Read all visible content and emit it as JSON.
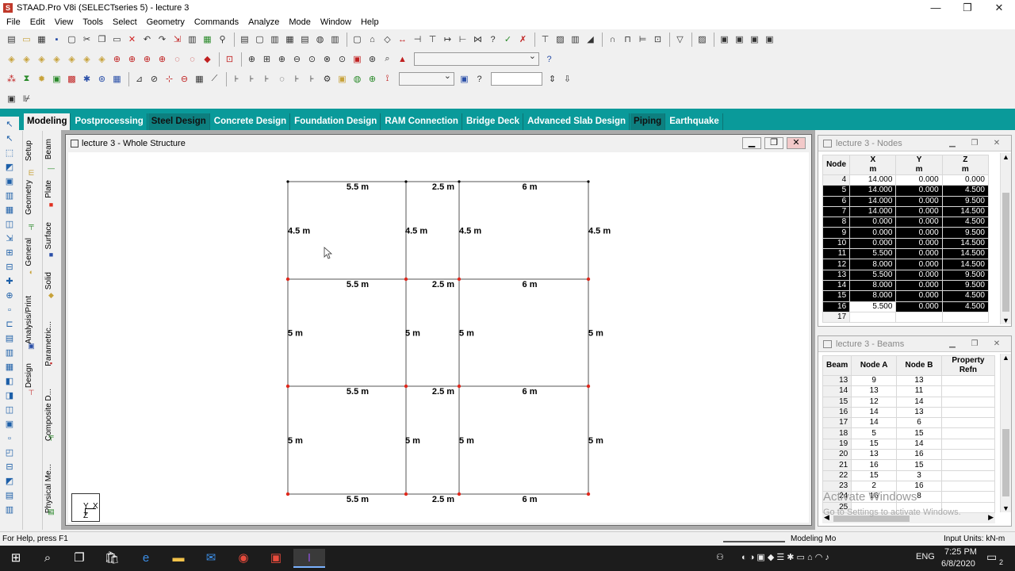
{
  "app": {
    "title": "STAAD.Pro V8i (SELECTseries 5) - lecture 3",
    "icon": "staad-app-icon"
  },
  "menu": [
    "File",
    "Edit",
    "View",
    "Tools",
    "Select",
    "Geometry",
    "Commands",
    "Analyze",
    "Mode",
    "Window",
    "Help"
  ],
  "tabs": [
    {
      "label": "Modeling",
      "state": "active"
    },
    {
      "label": "Postprocessing",
      "state": ""
    },
    {
      "label": "Steel Design",
      "state": "hl"
    },
    {
      "label": "Concrete Design",
      "state": ""
    },
    {
      "label": "Foundation Design",
      "state": ""
    },
    {
      "label": "RAM Connection",
      "state": ""
    },
    {
      "label": "Bridge Deck",
      "state": ""
    },
    {
      "label": "Advanced Slab Design",
      "state": ""
    },
    {
      "label": "Piping",
      "state": "hl"
    },
    {
      "label": "Earthquake",
      "state": ""
    }
  ],
  "vtabs1": [
    "Setup",
    "Geometry",
    "General",
    "Analysis/Print",
    "Design"
  ],
  "vtabs2": [
    "Beam",
    "Plate",
    "Surface",
    "Solid",
    "Parametric...",
    "Composite D...",
    "Physical Me..."
  ],
  "structure_window": {
    "title": "lecture 3 - Whole Structure",
    "span_labels_x": [
      "5.5 m",
      "2.5 m",
      "6 m"
    ],
    "row_labels": [
      {
        "labels": [
          "4.5 m",
          "4.5 m",
          "4.5 m",
          "4.5 m"
        ]
      },
      {
        "labels": [
          "5 m",
          "5 m",
          "5 m",
          "5 m"
        ]
      },
      {
        "labels": [
          "5 m",
          "5 m",
          "5 m",
          "5 m"
        ]
      }
    ],
    "axes": {
      "y": "Y",
      "x": "X",
      "z": "Z"
    }
  },
  "nodes_panel": {
    "title": "lecture 3 - Nodes",
    "headers": [
      "Node",
      "X\nm",
      "Y\nm",
      "Z\nm"
    ],
    "header_node": "Node",
    "header_x": "X",
    "header_y": "Y",
    "header_z": "Z",
    "unit": "m",
    "rows": [
      {
        "id": "4",
        "x": "14.000",
        "y": "0.000",
        "z": "0.000",
        "sel": false
      },
      {
        "id": "5",
        "x": "14.000",
        "y": "0.000",
        "z": "4.500",
        "sel": true
      },
      {
        "id": "6",
        "x": "14.000",
        "y": "0.000",
        "z": "9.500",
        "sel": true
      },
      {
        "id": "7",
        "x": "14.000",
        "y": "0.000",
        "z": "14.500",
        "sel": true
      },
      {
        "id": "8",
        "x": "0.000",
        "y": "0.000",
        "z": "4.500",
        "sel": true
      },
      {
        "id": "9",
        "x": "0.000",
        "y": "0.000",
        "z": "9.500",
        "sel": true
      },
      {
        "id": "10",
        "x": "0.000",
        "y": "0.000",
        "z": "14.500",
        "sel": true
      },
      {
        "id": "11",
        "x": "5.500",
        "y": "0.000",
        "z": "14.500",
        "sel": true
      },
      {
        "id": "12",
        "x": "8.000",
        "y": "0.000",
        "z": "14.500",
        "sel": true
      },
      {
        "id": "13",
        "x": "5.500",
        "y": "0.000",
        "z": "9.500",
        "sel": true
      },
      {
        "id": "14",
        "x": "8.000",
        "y": "0.000",
        "z": "9.500",
        "sel": true
      },
      {
        "id": "15",
        "x": "8.000",
        "y": "0.000",
        "z": "4.500",
        "sel": true
      },
      {
        "id": "16",
        "x": "5.500",
        "y": "0.000",
        "z": "4.500",
        "sel": "partial"
      },
      {
        "id": "17",
        "x": "",
        "y": "",
        "z": "",
        "sel": false
      }
    ]
  },
  "beams_panel": {
    "title": "lecture 3 - Beams",
    "header_beam": "Beam",
    "header_a": "Node A",
    "header_b": "Node B",
    "header_prop": "Property Refn",
    "rows": [
      {
        "id": "13",
        "a": "9",
        "b": "13"
      },
      {
        "id": "14",
        "a": "13",
        "b": "11"
      },
      {
        "id": "15",
        "a": "12",
        "b": "14"
      },
      {
        "id": "16",
        "a": "14",
        "b": "13"
      },
      {
        "id": "17",
        "a": "14",
        "b": "6"
      },
      {
        "id": "18",
        "a": "5",
        "b": "15"
      },
      {
        "id": "19",
        "a": "15",
        "b": "14"
      },
      {
        "id": "20",
        "a": "13",
        "b": "16"
      },
      {
        "id": "21",
        "a": "16",
        "b": "15"
      },
      {
        "id": "22",
        "a": "15",
        "b": "3"
      },
      {
        "id": "23",
        "a": "2",
        "b": "16"
      },
      {
        "id": "24",
        "a": "16",
        "b": "8"
      },
      {
        "id": "25",
        "a": "",
        "b": ""
      }
    ]
  },
  "watermark": {
    "line1": "Activate Windows",
    "line2": "Go to Settings to activate Windows."
  },
  "status": {
    "help": "For Help, press F1",
    "mode": "Modeling Mo",
    "units": "Input Units:  kN-m"
  },
  "taskbar": {
    "lang": "ENG",
    "time": "7:25 PM",
    "date": "6/8/2020",
    "notif": "2"
  },
  "colors": {
    "tabbar": "#0a9a9a",
    "selected_row": "#000000",
    "node_red": "#e0281c"
  }
}
